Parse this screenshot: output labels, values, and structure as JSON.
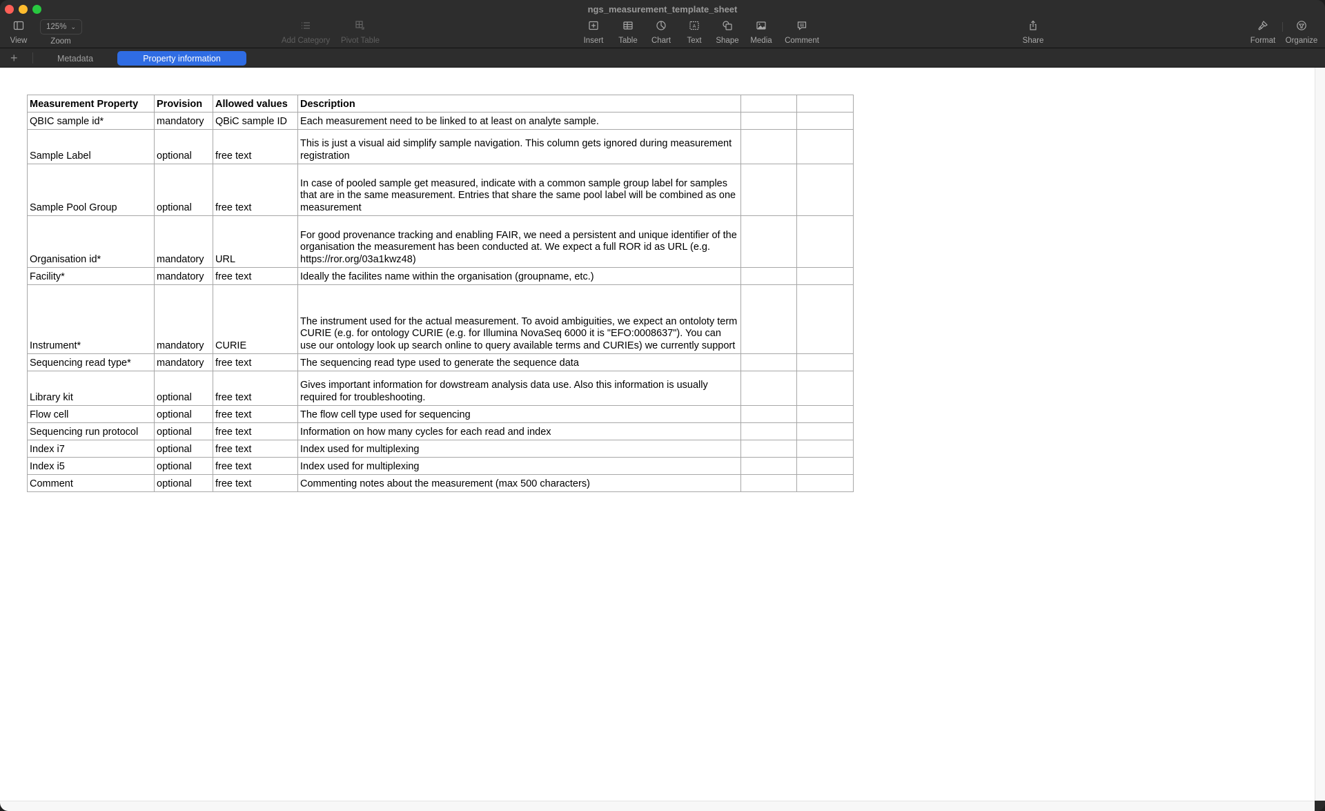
{
  "window": {
    "title": "ngs_measurement_template_sheet"
  },
  "toolbar": {
    "view_label": "View",
    "zoom_value": "125%",
    "zoom_label": "Zoom",
    "add_category_label": "Add Category",
    "pivot_table_label": "Pivot Table",
    "insert_label": "Insert",
    "table_label": "Table",
    "chart_label": "Chart",
    "text_label": "Text",
    "shape_label": "Shape",
    "media_label": "Media",
    "comment_label": "Comment",
    "share_label": "Share",
    "format_label": "Format",
    "organize_label": "Organize"
  },
  "tabs": {
    "add_label": "+",
    "items": [
      {
        "label": "Metadata",
        "active": false
      },
      {
        "label": "Property information",
        "active": true
      }
    ]
  },
  "sheet": {
    "headers": [
      "Measurement Property",
      "Provision",
      "Allowed values",
      "Description",
      "",
      ""
    ],
    "rows": [
      {
        "property": "QBIC sample id*",
        "provision": "mandatory",
        "allowed": "QBiC sample ID",
        "description": "Each measurement need to be linked to at least on analyte sample."
      },
      {
        "property": "Sample Label",
        "provision": "optional",
        "allowed": "free text",
        "description": "This is just a visual aid simplify sample navigation. This column gets ignored during measurement registration"
      },
      {
        "property": "Sample Pool Group",
        "provision": "optional",
        "allowed": "free text",
        "description": "In case of pooled sample get measured, indicate with a common sample group label for samples that are in the same measurement. Entries that share the same pool label will be combined as one measurement"
      },
      {
        "property": "Organisation id*",
        "provision": "mandatory",
        "allowed": "URL",
        "description": "For good provenance tracking and enabling FAIR, we need a persistent and unique identifier of the organisation the measurement has been conducted at. We expect a full ROR id as URL (e.g. https://ror.org/03a1kwz48)"
      },
      {
        "property": "Facility*",
        "provision": "mandatory",
        "allowed": "free text",
        "description": "Ideally the facilites name within the organisation (groupname, etc.)"
      },
      {
        "property": "Instrument*",
        "provision": "mandatory",
        "allowed": "CURIE",
        "description": "The instrument used for the actual measurement. To avoid ambiguities, we expect an ontoloty term CURIE (e.g. for ontology CURIE (e.g. for Illumina NovaSeq 6000 it is \"EFO:0008637\"). You can use our ontology look up search online to query available terms and CURIEs) we currently support"
      },
      {
        "property": "Sequencing read type*",
        "provision": "mandatory",
        "allowed": "free text",
        "description": "The sequencing read type used to generate the sequence data"
      },
      {
        "property": "Library kit",
        "provision": "optional",
        "allowed": "free text",
        "description": "Gives important information for dowstream analysis data use. Also this information is usually required for troubleshooting."
      },
      {
        "property": "Flow cell",
        "provision": "optional",
        "allowed": "free text",
        "description": "The flow cell type used for sequencing"
      },
      {
        "property": "Sequencing run protocol",
        "provision": "optional",
        "allowed": "free text",
        "description": "Information on how many cycles for each read and index"
      },
      {
        "property": "Index i7",
        "provision": "optional",
        "allowed": "free text",
        "description": "Index used for multiplexing"
      },
      {
        "property": "Index i5",
        "provision": "optional",
        "allowed": "free text",
        "description": "Index used for multiplexing"
      },
      {
        "property": "Comment",
        "provision": "optional",
        "allowed": "free text",
        "description": "Commenting notes about the measurement (max 500 characters)"
      }
    ]
  }
}
